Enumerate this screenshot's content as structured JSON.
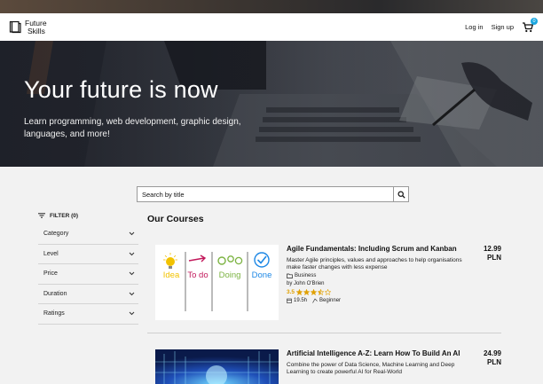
{
  "header": {
    "logo_line1": "Future",
    "logo_line2": "Skills",
    "login": "Log in",
    "signup": "Sign up",
    "cart_count": "0",
    "cart_icon": "cart-icon"
  },
  "hero": {
    "title": "Your future is now",
    "subtitle": "Learn programming, web development, graphic design, languages, and more!"
  },
  "search": {
    "placeholder": "Search by title",
    "icon": "search-icon"
  },
  "filters": {
    "heading": "FILTER (0)",
    "items": [
      {
        "label": "Category"
      },
      {
        "label": "Level"
      },
      {
        "label": "Price"
      },
      {
        "label": "Duration"
      },
      {
        "label": "Ratings"
      }
    ]
  },
  "main": {
    "title": "Our Courses"
  },
  "courses": [
    {
      "title": "Agile Fundamentals: Including Scrum and Kanban",
      "description": "Master Agile principles, values and approaches to help organisations make faster changes with less expense",
      "category": "Business",
      "author": "by John O'Brien",
      "rating": "3.5",
      "rating_stars": 3.5,
      "hours": "19.5h",
      "level": "Beginner",
      "price_amount": "12.99",
      "price_currency": "PLN",
      "thumb_labels": [
        "Idea",
        "To do",
        "Doing",
        "Done"
      ],
      "thumb_colors": [
        "#f2c200",
        "#c2185b",
        "#7cb342",
        "#1e88e5"
      ]
    },
    {
      "title": "Artificial Intelligence A-Z: Learn How To Build An AI",
      "description": "Combine the power of Data Science, Machine Learning and Deep Learning to create powerful AI for Real-World",
      "price_amount": "24.99",
      "price_currency": "PLN"
    }
  ],
  "colors": {
    "accent": "#1ba7e0",
    "star": "#e0a000"
  }
}
